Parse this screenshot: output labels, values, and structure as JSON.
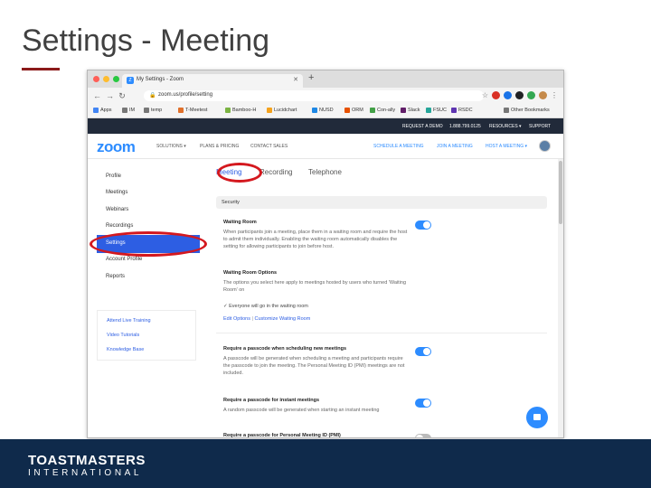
{
  "slide": {
    "title": "Settings - Meeting"
  },
  "browser": {
    "tab_title": "My Settings - Zoom",
    "url": "zoom.us/profile/setting",
    "bookmarks": [
      "Apps",
      "IM",
      "temp",
      "T-Meetest",
      "Bamboo-H",
      "Lucidchart",
      "NUSD",
      "ORM",
      "Con-ally",
      "Slack",
      "FSUC",
      "RSDC"
    ],
    "other_bookmarks": "Other Bookmarks"
  },
  "zoom": {
    "topbar": [
      "REQUEST A DEMO",
      "1.888.799.0125",
      "RESOURCES ▾",
      "SUPPORT"
    ],
    "logo": "zoom",
    "nav_left": [
      "SOLUTIONS ▾",
      "PLANS & PRICING",
      "CONTACT SALES"
    ],
    "nav_right": [
      "SCHEDULE A MEETING",
      "JOIN A MEETING",
      "HOST A MEETING ▾"
    ]
  },
  "sidebar": {
    "items": [
      {
        "label": "Profile"
      },
      {
        "label": "Meetings"
      },
      {
        "label": "Webinars"
      },
      {
        "label": "Recordings"
      },
      {
        "label": "Settings"
      },
      {
        "label": "Account Profile"
      },
      {
        "label": "Reports"
      }
    ],
    "active_index": 4,
    "help_links": [
      "Attend Live Training",
      "Video Tutorials",
      "Knowledge Base"
    ]
  },
  "page_tabs": [
    "Meeting",
    "Recording",
    "Telephone"
  ],
  "section": "Security",
  "settings": [
    {
      "title": "Waiting Room",
      "desc": "When participants join a meeting, place them in a waiting room and require the host to admit them individually. Enabling the waiting room automatically disables the setting for allowing participants to join before host.",
      "on": true
    },
    {
      "title": "Waiting Room Options",
      "desc": "The options you select here apply to meetings hosted by users who turned 'Waiting Room' on",
      "on": null
    },
    {
      "title": "Require a passcode when scheduling new meetings",
      "desc": "A passcode will be generated when scheduling a meeting and participants require the passcode to join the meeting. The Personal Meeting ID (PMI) meetings are not included.",
      "on": true
    },
    {
      "title": "Require a passcode for instant meetings",
      "desc": "A random passcode will be generated when starting an instant meeting",
      "on": true
    },
    {
      "title": "Require a passcode for Personal Meeting ID (PMI)",
      "desc": "",
      "on": false
    }
  ],
  "waiting_room_check": "✓  Everyone will go in the waiting room",
  "waiting_room_links": {
    "edit": "Edit Options",
    "customize": "Customize Waiting Room"
  },
  "footer": {
    "brand_top": "TOASTMASTERS",
    "brand_bottom": "INTERNATIONAL"
  },
  "colors": {
    "zoom_blue": "#2d8cff",
    "annotation_red": "#d4181e",
    "footer_navy": "#0f2a4b"
  }
}
